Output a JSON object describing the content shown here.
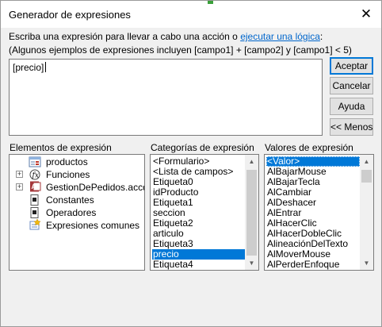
{
  "window": {
    "title": "Generador de expresiones"
  },
  "instructions": {
    "line1_prefix": "Escriba una expresión para llevar a cabo una acción o ",
    "line1_link": "ejecutar una lógica",
    "line1_suffix": ":",
    "line2": "(Algunos ejemplos de expresiones incluyen [campo1] + [campo2] y [campo1] < 5)"
  },
  "expression": {
    "value": "[precio]"
  },
  "buttons": {
    "accept": "Aceptar",
    "cancel": "Cancelar",
    "help": "Ayuda",
    "less": "<< Menos"
  },
  "elements": {
    "label": "Elementos de expresión",
    "items": [
      {
        "label": "productos",
        "icon": "form-icon",
        "expander": "none"
      },
      {
        "label": "Funciones",
        "icon": "function-icon",
        "expander": "plus"
      },
      {
        "label": "GestionDePedidos.accdb",
        "icon": "database-icon",
        "expander": "plus"
      },
      {
        "label": "Constantes",
        "icon": "constants-icon",
        "expander": "none"
      },
      {
        "label": "Operadores",
        "icon": "operators-icon",
        "expander": "none"
      },
      {
        "label": "Expresiones comunes",
        "icon": "common-expressions-icon",
        "expander": "none"
      }
    ]
  },
  "categories": {
    "label": "Categorías de expresión",
    "items": [
      "<Formulario>",
      "<Lista de campos>",
      "Etiqueta0",
      "idProducto",
      "Etiqueta1",
      "seccion",
      "Etiqueta2",
      "articulo",
      "Etiqueta3",
      "precio",
      "Etiqueta4"
    ],
    "selected": "precio"
  },
  "values": {
    "label": "Valores de expresión",
    "items": [
      "<Valor>",
      "AlBajarMouse",
      "AlBajarTecla",
      "AlCambiar",
      "AlDeshacer",
      "AlEntrar",
      "AlHacerClic",
      "AlHacerDobleClic",
      "AlineaciónDelTexto",
      "AlMoverMouse",
      "AlPerderEnfoque"
    ],
    "selected": "<Valor>"
  },
  "colors": {
    "selection": "#0078d7",
    "link": "#0066cc"
  }
}
